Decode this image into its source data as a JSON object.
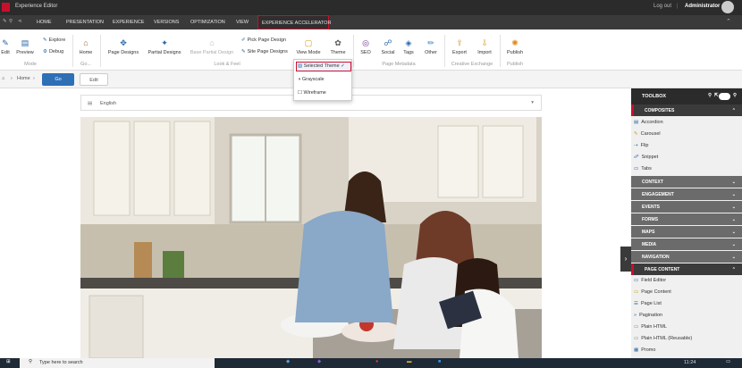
{
  "titlebar": {
    "app_title": "Experience Editor",
    "logout": "Log out",
    "separator": "|",
    "user": "Administrator"
  },
  "nav": {
    "tabs": [
      "HOME",
      "PRESENTATION",
      "EXPERIENCE",
      "VERSIONS",
      "OPTIMIZATION",
      "VIEW",
      "EXPERIENCE ACCELERATOR"
    ],
    "active_tab": "EXPERIENCE ACCELERATOR"
  },
  "ribbon": {
    "mode": {
      "buttons": [
        "Edit",
        "Preview"
      ],
      "small": [
        "Explore",
        "Debug"
      ],
      "group": "Mode"
    },
    "go": {
      "button": "Home",
      "group": "Go..."
    },
    "look_and_feel": {
      "buttons": [
        "Page Designs",
        "Partial Designs",
        "Base Partial Design"
      ],
      "small": [
        "Pick Page Design",
        "Site Page Designs"
      ],
      "view_mode": "View Mode",
      "theme": "Theme",
      "group": "Look & Feel"
    },
    "page_metadata": {
      "buttons": [
        "SEO",
        "Social",
        "Tags",
        "Other"
      ],
      "group": "Page Metadata"
    },
    "creative_exchange": {
      "buttons": [
        "Export",
        "Import"
      ],
      "group": "Creative Exchange"
    },
    "publish": {
      "buttons": [
        "Publish"
      ],
      "group": "Publish"
    }
  },
  "theme_menu": {
    "items": [
      "Selected Theme",
      "Grayscale",
      "Wireframe"
    ],
    "selected": "Selected Theme"
  },
  "breadcrumb": {
    "items": [
      "Home"
    ],
    "go": "Go",
    "edit": "Edit"
  },
  "page": {
    "language": "English"
  },
  "toolbox": {
    "title": "TOOLBOX",
    "sections": [
      {
        "name": "COMPOSITES",
        "expanded": true,
        "items": [
          "Accordion",
          "Carousel",
          "Flip",
          "Snippet",
          "Tabs"
        ]
      },
      {
        "name": "CONTEXT",
        "expanded": false
      },
      {
        "name": "ENGAGEMENT",
        "expanded": false
      },
      {
        "name": "EVENTS",
        "expanded": false
      },
      {
        "name": "FORMS",
        "expanded": false
      },
      {
        "name": "MAPS",
        "expanded": false
      },
      {
        "name": "MEDIA",
        "expanded": false
      },
      {
        "name": "NAVIGATION",
        "expanded": false
      },
      {
        "name": "PAGE CONTENT",
        "expanded": true,
        "items": [
          "Field Editor",
          "Page Content",
          "Page List",
          "Pagination",
          "Plain HTML",
          "Plain HTML (Reusable)",
          "Promo"
        ]
      }
    ]
  },
  "taskbar": {
    "search_placeholder": "Type here to search",
    "time": "11:24"
  },
  "colors": {
    "accent_red": "#c8102e",
    "go_blue": "#2e6fb6",
    "dark": "#2b2b2b",
    "section_gray": "#6b6b6b"
  }
}
